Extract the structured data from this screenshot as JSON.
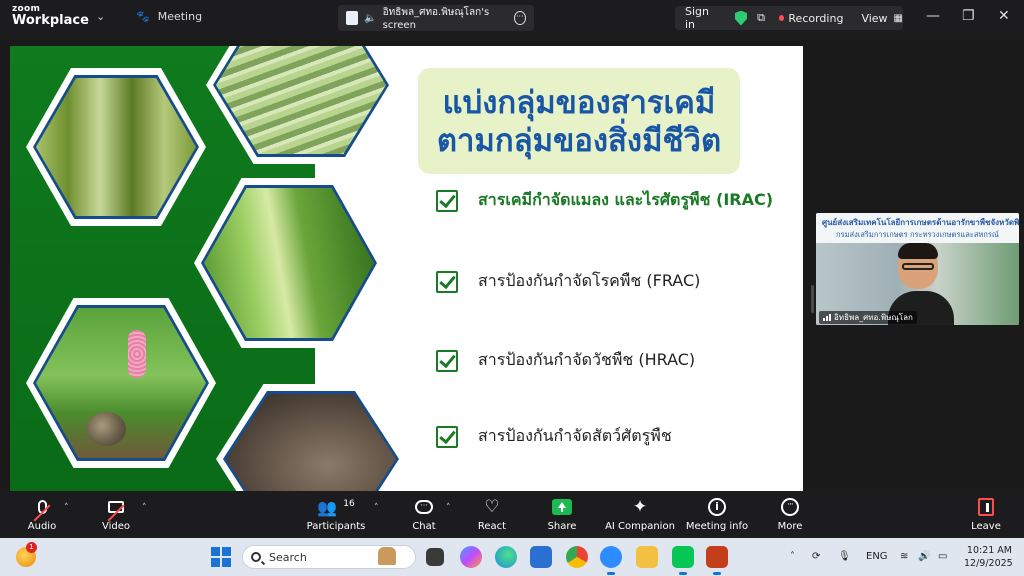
{
  "topbar": {
    "brand_small": "zoom",
    "brand_large": "Workplace",
    "meeting_label": "Meeting",
    "share_title": "อิทธิพล_ศทอ.พิษณุโลก's screen",
    "sign_in": "Sign in",
    "recording": "Recording",
    "view": "View"
  },
  "slide": {
    "title_line1": "แบ่งกลุ่มของสารเคมี",
    "title_line2": "ตามกลุ่มของสิ่งมีชีวิต",
    "items": [
      "สารเคมีกำจัดแมลง และไรศัตรูพืช (IRAC)",
      "สารป้องกันกำจัดโรคพืช (FRAC)",
      "สารป้องกันกำจัดวัชพืช (HRAC)",
      "สารป้องกันกำจัดสัตว์ศัตรูพืช"
    ]
  },
  "video_tile": {
    "banner_line1": "ศูนย์ส่งเสริมเทคโนโลยีการเกษตรด้านอารักขาพืชจังหวัดพิษ",
    "banner_line2": "กรมส่งเสริมการเกษตร   กระทรวงเกษตรและสหกรณ์",
    "participant_name": "อิทธิพล_ศทอ.พิษณุโลก"
  },
  "toolbar": {
    "audio": "Audio",
    "video": "Video",
    "participants": "Participants",
    "participant_count": "16",
    "chat": "Chat",
    "react": "React",
    "share": "Share",
    "ai_companion": "AI Companion",
    "meeting_info": "Meeting info",
    "more": "More",
    "leave": "Leave"
  },
  "taskbar": {
    "weather_badge": "1",
    "search_placeholder": "Search",
    "language": "ENG",
    "time": "10:21 AM",
    "date": "12/9/2025"
  },
  "colors": {
    "slide_green": "#0f7a1e",
    "title_blue": "#1957a6",
    "check_green": "#1a7a26",
    "title_box_bg": "#e8f2c8",
    "recording_red": "#ff4d4d",
    "share_green": "#1db954"
  },
  "icons": [
    "chevron-down-icon",
    "paw-icon",
    "shield-check-icon",
    "grid-icon",
    "minimize-icon",
    "restore-icon",
    "close-icon",
    "mic-off-icon",
    "video-off-icon",
    "participants-icon",
    "chat-icon",
    "heart-icon",
    "share-screen-icon",
    "sparkle-icon",
    "info-icon",
    "more-icon",
    "leave-icon",
    "windows-icon",
    "search-icon",
    "checkbox-icon"
  ]
}
